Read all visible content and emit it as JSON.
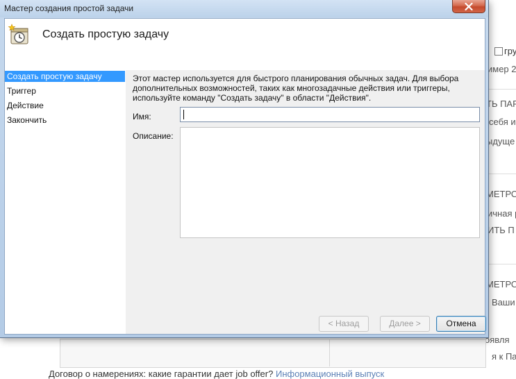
{
  "background_page": {
    "checkbox_label": "гру",
    "fragments": [
      "имер 2",
      "ТЬ ПАР",
      "себя и",
      "ыдуще",
      "МЕТРО",
      "ичная р",
      "ИТЬ П",
      "МЕТРО",
      "Ваши",
      "оявля",
      "я к Пав"
    ],
    "bottom_text": "Договор о намерениях: какие гарантии дает job offer?",
    "bottom_link": "Информационный выпуск"
  },
  "dialog": {
    "title": "Мастер создания простой задачи",
    "header_title": "Создать простую задачу",
    "nav": [
      {
        "label": "Создать простую задачу",
        "selected": true
      },
      {
        "label": "Триггер",
        "selected": false
      },
      {
        "label": "Действие",
        "selected": false
      },
      {
        "label": "Закончить",
        "selected": false
      }
    ],
    "description": "Этот мастер используется для быстрого планирования обычных задач.  Для выбора дополнительных возможностей, таких как многозадачные действия или триггеры, используйте команду \"Создать задачу\" в области \"Действия\".",
    "name_label": "Имя:",
    "name_value": "",
    "description_label": "Описание:",
    "description_value": "",
    "buttons": {
      "back": "< Назад",
      "next": "Далее >",
      "cancel": "Отмена"
    }
  },
  "icons": {
    "close": "close-icon",
    "header": "scheduled-task-clock-icon"
  }
}
